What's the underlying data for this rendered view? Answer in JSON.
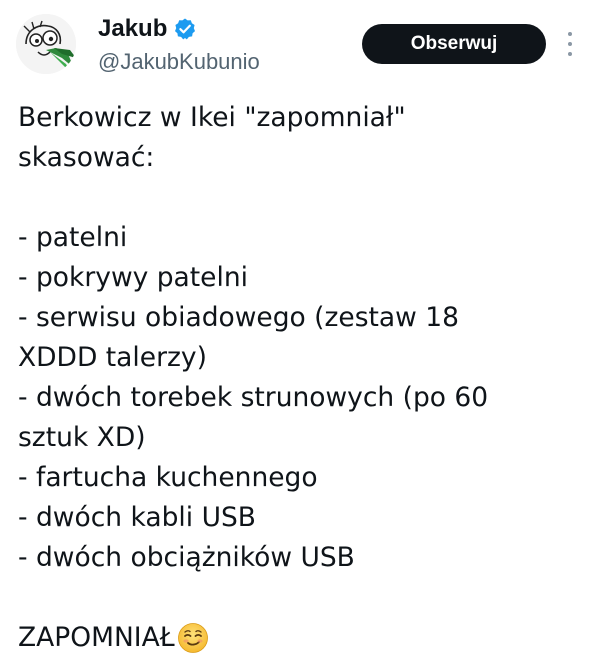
{
  "author": {
    "display_name": "Jakub",
    "handle": "@JakubKubunio",
    "verified": true,
    "avatar_icon": "cartoon-avatar-icon"
  },
  "actions": {
    "follow_label": "Obserwuj",
    "more_icon": "more-options-icon"
  },
  "colors": {
    "verified_badge": "#1d9bf0",
    "follow_button_bg": "#0f1419",
    "follow_button_text": "#ffffff",
    "handle_text": "#536471",
    "body_text": "#0f1419"
  },
  "tweet": {
    "lines": [
      "Berkowicz w Ikei \"zapomniał\"",
      "skasować:",
      "",
      "- patelni",
      "- pokrywy patelni",
      "- serwisu obiadowego (zestaw 18",
      "XDDD talerzy)",
      "- dwóch torebek strunowych (po 60",
      "sztuk XD)",
      "- fartucha kuchennego",
      "- dwóch kabli USB",
      "- dwóch obciążników USB",
      "",
      "ZAPOMNIAŁ"
    ],
    "final_emoji": "smirking-face-emoji"
  }
}
